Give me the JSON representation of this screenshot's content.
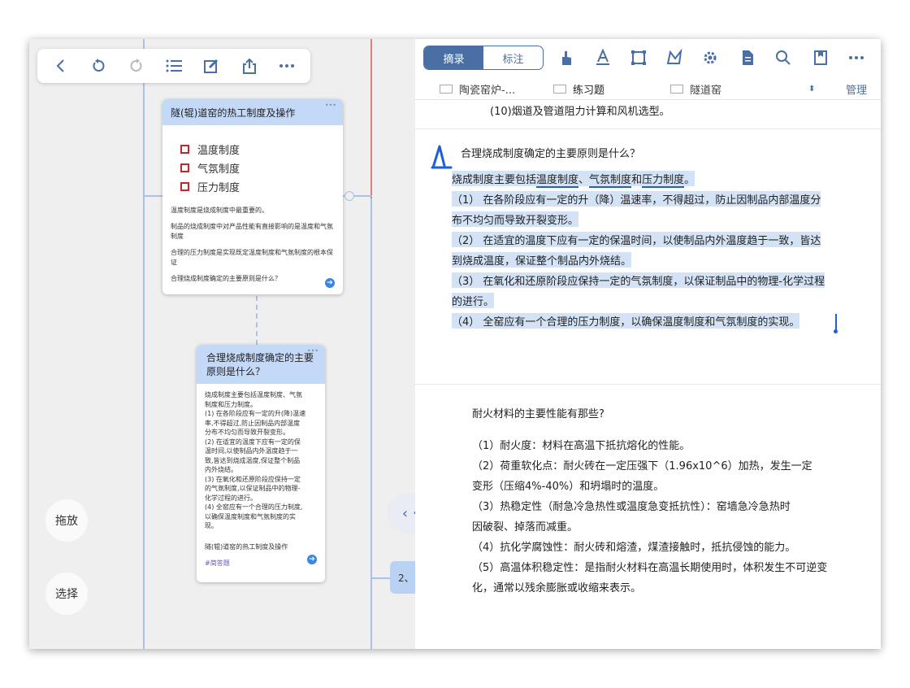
{
  "toolbar": {
    "icons": [
      "back-icon",
      "undo-icon",
      "redo-icon",
      "list-icon",
      "edit-icon",
      "share-icon",
      "more-icon"
    ]
  },
  "card1": {
    "title": "隧(辊)道窑的热工制度及操作",
    "bullets": [
      "温度制度",
      "气氛制度",
      "压力制度"
    ],
    "notes": [
      "温度制度是烧成制度中最重要的。",
      "制品的烧成制度中对产品性能有直接影响的是温度和气氛制度",
      "合理的压力制度是实现既定温度制度和气氛制度的根本保证"
    ],
    "link": "合理烧成制度确定的主要原则是什么？"
  },
  "card2": {
    "title": "合理烧成制度确定的主要原则是什么？",
    "body": [
      "烧成制度主要包括温度制度、气氛",
      "制度和压力制度。",
      "(1) 在各阶段应有一定的升(降)温速",
      "率,不得超过,防止因制品内部温度",
      "分布不均匀而导致开裂变形。",
      "(2) 在适宜的温度下应有一定的保",
      "温时间,以使制品内外温度趋于一",
      "致,皆达到烧成温度,保证整个制品",
      "内外烧结。",
      "(3) 在氧化和还原阶段应保持一定",
      "的气氛制度,以保证制品中的物理-",
      "化学过程的进行。",
      "(4) 全窑应有一个合理的压力制度,",
      "以确保温度制度和气氛制度的实",
      "现。"
    ],
    "link": "隧(辊)道窑的热工制度及操作",
    "tag": "#简答题"
  },
  "left_buttons": {
    "drag": "拖放",
    "select": "选择"
  },
  "partial_node": "2、",
  "segment": {
    "excerpt": "摘录",
    "annotate": "标注"
  },
  "tabs": {
    "tab1": "陶瓷窑炉-...",
    "tab2": "练习题",
    "tab3": "隧道窑",
    "manage": "管理"
  },
  "doc": {
    "line0": "(10)烟道及管道阻力计算和风机选型。",
    "q1": "合理烧成制度确定的主要原则是什么？",
    "a1_lead": "烧成制度主要包括",
    "a1_t1": "温度制度",
    "a1_sep1": "、",
    "a1_t2": "气氛制度",
    "a1_and": "和",
    "a1_t3": "压力制度",
    "a1_end": "。",
    "a1_lines": [
      "（1） 在各阶段应有一定的升（降）温速率，不得超过，防止因制品内部温度分",
      "布不均匀而导致开裂变形。",
      "（2） 在适宜的温度下应有一定的保温时间，以使制品内外温度趋于一致，皆达",
      "到烧成温度，保证整个制品内外烧结。",
      "（3） 在氧化和还原阶段应保持一定的气氛制度，以保证制品中的物理-化学过程",
      "的进行。",
      "（4） 全窑应有一个合理的压力制度，以确保温度制度和气氛制度的实现。"
    ],
    "q2": "耐火材料的主要性能有那些?",
    "a2_lines": [
      "（1）耐火度：材料在高温下抵抗熔化的性能。",
      "（2）荷重软化点：耐火砖在一定压强下（1.96x10^6）加热，发生一定",
      "变形（压缩4%-40%）和坍塌时的温度。",
      "（3）热稳定性（耐急冷急热性或温度急变抵抗性）：窑墙急冷急热时",
      "因破裂、掉落而减重。",
      "（4）抗化学腐蚀性：耐火砖和熔渣，煤渣接触时，抵抗侵蚀的能力。",
      "（5）高温体积稳定性：是指耐火材料在高温长期使用时，体积发生不可逆变",
      "化，通常以残余膨胀或收缩来表示。"
    ]
  },
  "colors": {
    "accent": "#4a6fa5",
    "highlight": "#d3e2f5",
    "ink_blue": "#1f5fd6",
    "bullet_red": "#c0282d"
  }
}
